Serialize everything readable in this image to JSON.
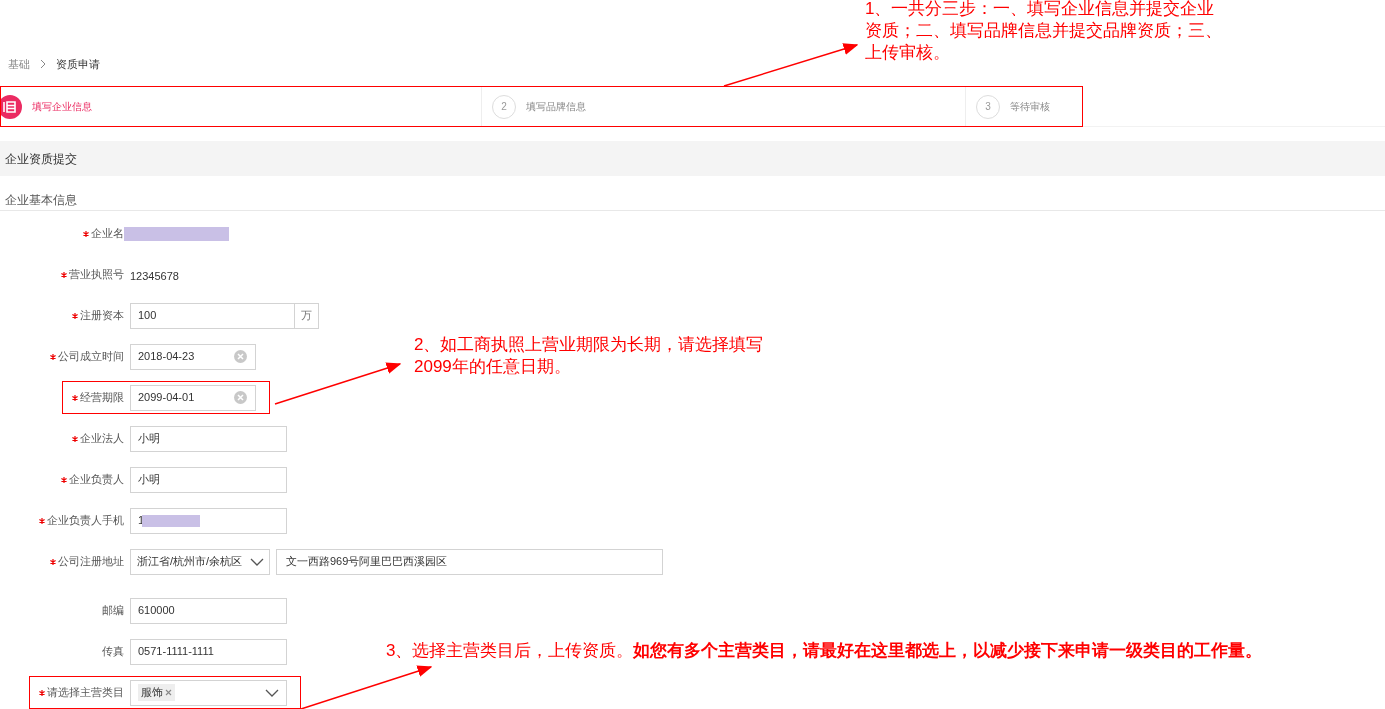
{
  "breadcrumb": [
    {
      "label": "基础",
      "current": false
    },
    {
      "label": "资质申请",
      "current": true
    }
  ],
  "steps": [
    {
      "kind": "icon",
      "label": "填写企业信息",
      "selected": true
    },
    {
      "kind": "number",
      "number": "2",
      "label": "填写品牌信息",
      "selected": false
    },
    {
      "kind": "number",
      "number": "3",
      "label": "等待审核",
      "selected": false
    }
  ],
  "section_title": "企业资质提交",
  "subsection_title": "企业基本信息",
  "fields": [
    {
      "kind": "redacted",
      "label": "企业名",
      "required": true,
      "annotated": false
    },
    {
      "kind": "static",
      "label": "营业执照号",
      "value": "12345678",
      "required": true,
      "annotated": false
    },
    {
      "kind": "addon",
      "label": "注册资本",
      "value": "100",
      "addon": "万",
      "required": true,
      "annotated": false
    },
    {
      "kind": "date",
      "label": "公司成立时间",
      "value": "2018-04-23",
      "required": true,
      "annotated": false
    },
    {
      "kind": "date",
      "label": "经营期限",
      "value": "2099-04-01",
      "required": true,
      "annotated": true
    },
    {
      "kind": "input",
      "label": "企业法人",
      "value": "小明",
      "required": true,
      "annotated": false
    },
    {
      "kind": "input",
      "label": "企业负责人",
      "value": "小明",
      "required": true,
      "annotated": false
    },
    {
      "kind": "redacted_input",
      "label": "企业负责人手机",
      "value": "1",
      "required": true,
      "annotated": false
    },
    {
      "kind": "region",
      "label": "公司注册地址",
      "value": "浙江省/杭州市/余杭区",
      "detail": "文一西路969号阿里巴巴西溪园区",
      "required": true,
      "annotated": false
    },
    {
      "kind": "input",
      "label": "邮编",
      "value": "610000",
      "required": false,
      "annotated": false
    },
    {
      "kind": "input",
      "label": "传真",
      "value": "0571-1111-1111",
      "required": false,
      "annotated": false
    },
    {
      "kind": "tags",
      "label": "请选择主营类目",
      "tags": [
        "服饰"
      ],
      "required": true,
      "annotated": true
    }
  ],
  "annotations": [
    {
      "text": "1、一共分三步：一、填写企业信息并提交企业资质；二、填写品牌信息并提交品牌资质；三、上传审核。"
    },
    {
      "text": "2、如工商执照上营业期限为长期，请选择填写2099年的任意日期。"
    },
    {
      "text": "3、选择主营类目后，上传资质。**如您有多个主营类目，请最好在这里都选上，以减少接下来申请一级类目的工作量。**"
    }
  ]
}
